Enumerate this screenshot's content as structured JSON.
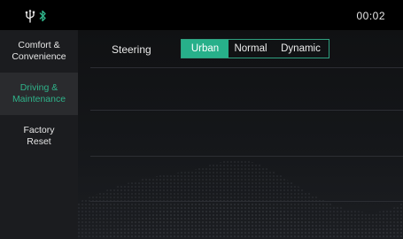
{
  "status_bar": {
    "clock": "00:02",
    "icons": [
      "usb-icon",
      "bluetooth-icon"
    ],
    "bluetooth_color": "#2fb38a"
  },
  "sidebar": {
    "items": [
      {
        "label": "Comfort &\nConvenience",
        "active": false
      },
      {
        "label": "Driving &\nMaintenance",
        "active": true
      },
      {
        "label": "Factory\nReset",
        "active": false
      }
    ]
  },
  "settings": {
    "steering": {
      "label": "Steering",
      "options": [
        "Urban",
        "Normal",
        "Dynamic"
      ],
      "selected": "Urban"
    }
  },
  "colors": {
    "accent": "#27b08a",
    "active_text": "#2fb38a"
  }
}
